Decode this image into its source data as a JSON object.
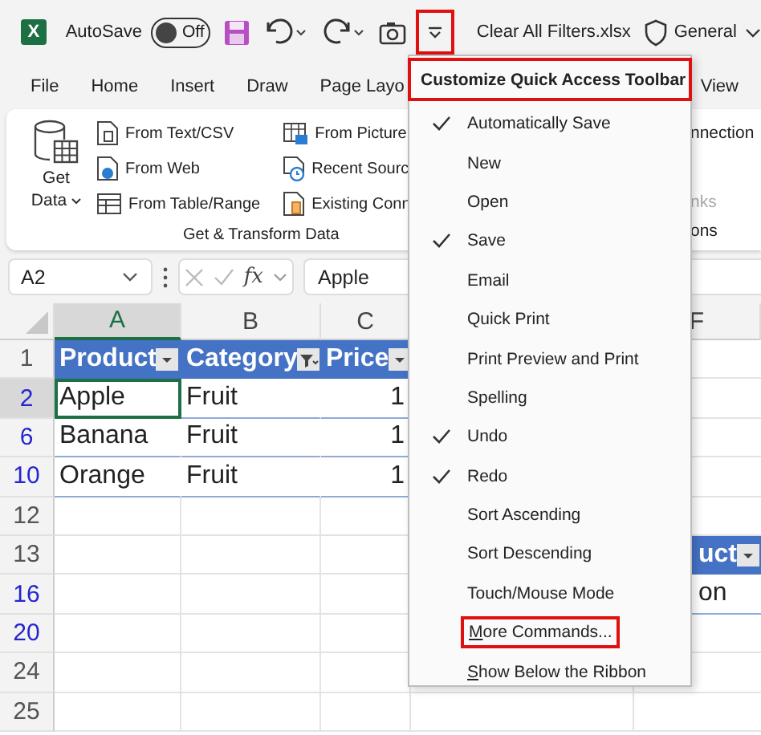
{
  "title_bar": {
    "app_logo": "X",
    "autosave": {
      "label": "AutoSave",
      "on": false,
      "state_text": "Off"
    },
    "customize_button": {
      "highlighted": true
    },
    "file_name": "Clear All Filters.xlsx",
    "sensitivity": "General"
  },
  "ribbon_tabs": [
    "File",
    "Home",
    "Insert",
    "Draw",
    "Page Layo",
    "View"
  ],
  "ribbon": {
    "get_data": {
      "line_1": "Get",
      "line_2": "Data"
    },
    "commands": [
      {
        "label": "From Text/CSV",
        "kind": "text-file"
      },
      {
        "label": "From Web",
        "kind": "web"
      },
      {
        "label": "From Table/Range",
        "kind": "table"
      },
      {
        "label": "From Picture",
        "kind": "picture"
      },
      {
        "label": "Recent Sourc",
        "kind": "recent"
      },
      {
        "label": "Existing Conn",
        "kind": "existing"
      }
    ],
    "group_label": "Get & Transform Data",
    "right_group": {
      "items": [
        {
          "label": "nnection",
          "disabled": false
        },
        {
          "label": "nks",
          "disabled": true
        }
      ],
      "group_label": "ons"
    }
  },
  "formula_bar": {
    "name_box": "A2",
    "function_label": "fx",
    "value": "Apple"
  },
  "sheet": {
    "columns": [
      {
        "label": "A",
        "selected": true
      },
      {
        "label": "B",
        "selected": false
      },
      {
        "label": "C",
        "selected": false
      },
      {
        "label": "F",
        "selected": false
      }
    ],
    "rows": [
      {
        "number": "1",
        "filtered": false,
        "cells": [
          {
            "text": "Product",
            "kind": "header",
            "filter_applied": false
          },
          {
            "text": "Category",
            "kind": "header",
            "filter_applied": true
          },
          {
            "text": "Price",
            "kind": "header",
            "filter_applied": false
          }
        ]
      },
      {
        "number": "2",
        "filtered": true,
        "cells": [
          {
            "text": "Apple",
            "kind": "text",
            "selected": true
          },
          {
            "text": "Fruit",
            "kind": "text",
            "selected": false
          },
          {
            "text": "1",
            "kind": "number",
            "selected": false
          }
        ]
      },
      {
        "number": "6",
        "filtered": true,
        "cells": [
          {
            "text": "Banana",
            "kind": "text",
            "selected": false
          },
          {
            "text": "Fruit",
            "kind": "text",
            "selected": false
          },
          {
            "text": "1",
            "kind": "number",
            "selected": false
          }
        ]
      },
      {
        "number": "10",
        "filtered": true,
        "cells": [
          {
            "text": "Orange",
            "kind": "text",
            "selected": false
          },
          {
            "text": "Fruit",
            "kind": "text",
            "selected": false
          },
          {
            "text": "1",
            "kind": "number",
            "selected": false
          }
        ]
      },
      {
        "number": "12",
        "filtered": false
      },
      {
        "number": "13",
        "filtered": false,
        "right_cell": {
          "text": "uct",
          "kind": "header",
          "filter_applied": false
        }
      },
      {
        "number": "16",
        "filtered": true,
        "right_cell": {
          "text": "on",
          "kind": "text",
          "selected": false
        }
      },
      {
        "number": "20",
        "filtered": true
      },
      {
        "number": "24",
        "filtered": false
      },
      {
        "number": "25",
        "filtered": false
      }
    ]
  },
  "dropdown": {
    "title": "Customize Quick Access Toolbar",
    "highlighted": true,
    "items": [
      {
        "label": "Automatically Save",
        "checked": true,
        "highlighted": false,
        "accelerator_underlined": false
      },
      {
        "label": "New",
        "checked": false,
        "highlighted": false,
        "accelerator_underlined": false
      },
      {
        "label": "Open",
        "checked": false,
        "highlighted": false,
        "accelerator_underlined": false
      },
      {
        "label": "Save",
        "checked": true,
        "highlighted": false,
        "accelerator_underlined": false
      },
      {
        "label": "Email",
        "checked": false,
        "highlighted": false,
        "accelerator_underlined": false
      },
      {
        "label": "Quick Print",
        "checked": false,
        "highlighted": false,
        "accelerator_underlined": false
      },
      {
        "label": "Print Preview and Print",
        "checked": false,
        "highlighted": false,
        "accelerator_underlined": false
      },
      {
        "label": "Spelling",
        "checked": false,
        "highlighted": false,
        "accelerator_underlined": false
      },
      {
        "label": "Undo",
        "checked": true,
        "highlighted": false,
        "accelerator_underlined": false
      },
      {
        "label": "Redo",
        "checked": true,
        "highlighted": false,
        "accelerator_underlined": false
      },
      {
        "label": "Sort Ascending",
        "checked": false,
        "highlighted": false,
        "accelerator_underlined": false
      },
      {
        "label": "Sort Descending",
        "checked": false,
        "highlighted": false,
        "accelerator_underlined": false
      },
      {
        "label": "Touch/Mouse Mode",
        "checked": false,
        "highlighted": false,
        "accelerator_underlined": false
      },
      {
        "label": "More Commands...",
        "checked": false,
        "highlighted": true,
        "accelerator_underlined": true
      },
      {
        "label": "Show Below the Ribbon",
        "checked": false,
        "highlighted": false,
        "accelerator_underlined": true
      }
    ]
  }
}
